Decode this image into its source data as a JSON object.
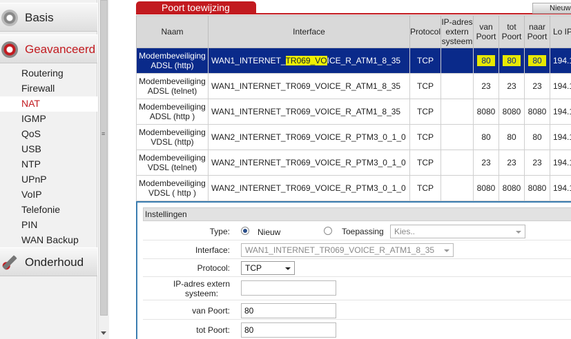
{
  "sidebar": {
    "sections": [
      {
        "label": "Basis"
      },
      {
        "label": "Geavanceerd"
      },
      {
        "label": "Onderhoud"
      }
    ],
    "submenu": [
      {
        "label": "Routering"
      },
      {
        "label": "Firewall"
      },
      {
        "label": "NAT"
      },
      {
        "label": "IGMP"
      },
      {
        "label": "QoS"
      },
      {
        "label": "USB"
      },
      {
        "label": "NTP"
      },
      {
        "label": "UPnP"
      },
      {
        "label": "VoIP"
      },
      {
        "label": "Telefonie"
      },
      {
        "label": "PIN"
      },
      {
        "label": "WAN Backup"
      }
    ]
  },
  "tab": {
    "title": "Poort toewijzing",
    "new_button": "Nieuw"
  },
  "table": {
    "headers": [
      "Naam",
      "Interface",
      "Protocol",
      "IP-adres extern systeem",
      "van Poort",
      "tot Poort",
      "naar Poort",
      "Lo IP-"
    ],
    "rows": [
      {
        "name": "Modembeveiliging ADSL (http)",
        "iface_a": "WAN1_INTERNET_",
        "iface_b": "TR069_VO",
        "iface_c": "ICE_R_ATM1_8_35",
        "protocol": "TCP",
        "ext": "",
        "van": "80",
        "tot": "80",
        "naar": "80",
        "ip": "194.1"
      },
      {
        "name": "Modembeveiliging ADSL (telnet)",
        "iface": "WAN1_INTERNET_TR069_VOICE_R_ATM1_8_35",
        "protocol": "TCP",
        "ext": "",
        "van": "23",
        "tot": "23",
        "naar": "23",
        "ip": "194.1"
      },
      {
        "name": "Modembeveiliging ADSL (http )",
        "iface": "WAN1_INTERNET_TR069_VOICE_R_ATM1_8_35",
        "protocol": "TCP",
        "ext": "",
        "van": "8080",
        "tot": "8080",
        "naar": "8080",
        "ip": "194.1"
      },
      {
        "name": "Modembeveiliging VDSL (http)",
        "iface": "WAN2_INTERNET_TR069_VOICE_R_PTM3_0_1_0",
        "protocol": "TCP",
        "ext": "",
        "van": "80",
        "tot": "80",
        "naar": "80",
        "ip": "194.1"
      },
      {
        "name": "Modembeveiliging VDSL (telnet)",
        "iface": "WAN2_INTERNET_TR069_VOICE_R_PTM3_0_1_0",
        "protocol": "TCP",
        "ext": "",
        "van": "23",
        "tot": "23",
        "naar": "23",
        "ip": "194.1"
      },
      {
        "name": "Modembeveiliging VDSL ( http )",
        "iface": "WAN2_INTERNET_TR069_VOICE_R_PTM3_0_1_0",
        "protocol": "TCP",
        "ext": "",
        "van": "8080",
        "tot": "8080",
        "naar": "8080",
        "ip": "194.1"
      }
    ]
  },
  "settings": {
    "title": "Instellingen",
    "type_label": "Type:",
    "type_new": "Nieuw",
    "type_app": "Toepassing",
    "app_select": "Kies..",
    "interface_label": "Interface:",
    "interface_value": "WAN1_INTERNET_TR069_VOICE_R_ATM1_8_35",
    "protocol_label": "Protocol:",
    "protocol_value": "TCP",
    "ext_label_1": "IP-adres extern",
    "ext_label_2": "systeem:",
    "ext_value": "",
    "van_label": "van Poort:",
    "van_value": "80",
    "tot_label": "tot Poort:",
    "tot_value": "80"
  }
}
